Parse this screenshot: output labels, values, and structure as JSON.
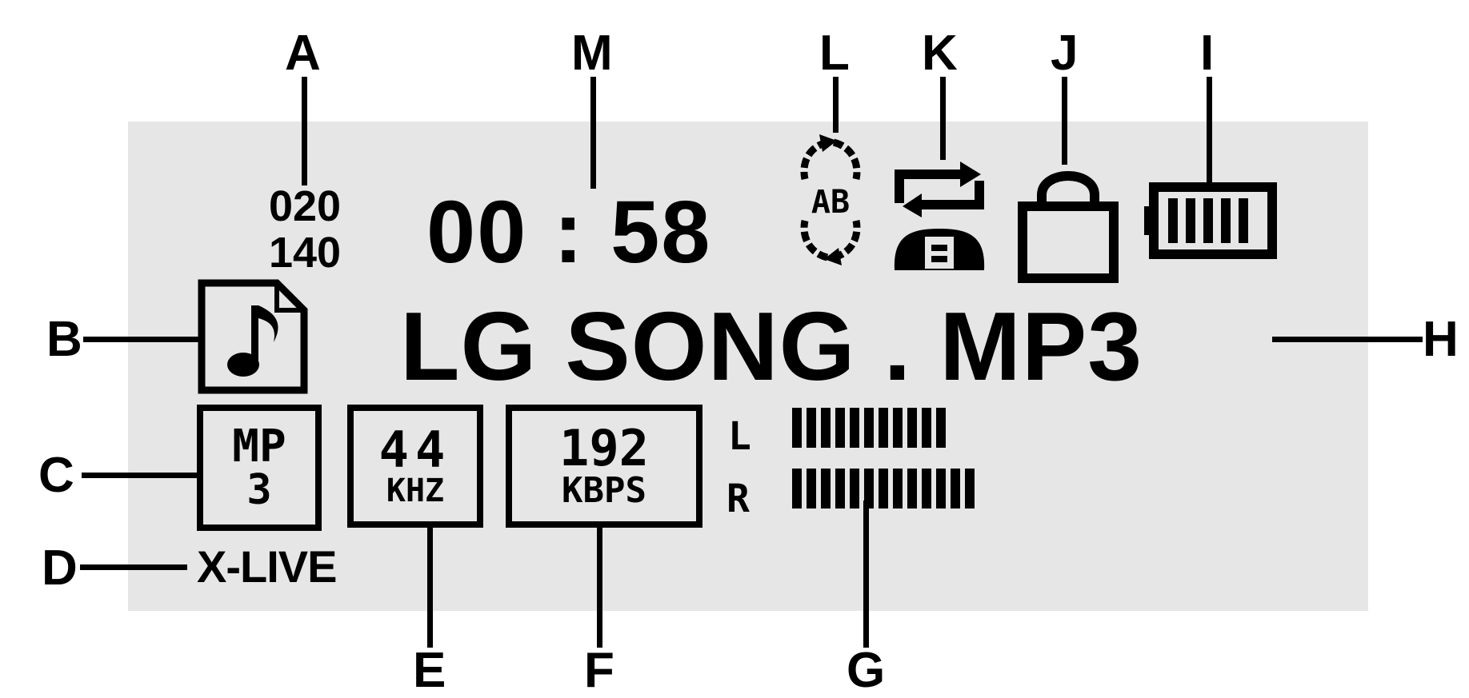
{
  "display": {
    "track_current": "020",
    "track_total": "140",
    "time": "00 : 58",
    "filename": "LG SONG . MP3",
    "format_top": "MP",
    "format_bottom": "3",
    "sample_rate_value": "44",
    "sample_rate_unit": "KHZ",
    "bitrate_value": "192",
    "bitrate_unit": "KBPS",
    "channel_left": "L",
    "channel_right": "R",
    "sound_effect": "X-LIVE",
    "ab_repeat": "AB",
    "level_left_bars": 11,
    "level_right_bars": 13,
    "battery_bars": 5
  },
  "callouts": {
    "a": "A",
    "b": "B",
    "c": "C",
    "d": "D",
    "e": "E",
    "f": "F",
    "g": "G",
    "h": "H",
    "i": "I",
    "j": "J",
    "k": "K",
    "l": "L",
    "m": "M"
  },
  "icons": {
    "file": "music-file-icon",
    "ab": "ab-repeat-icon",
    "repeat": "repeat-mode-icon",
    "lock": "lock-icon",
    "battery": "battery-icon"
  },
  "colors": {
    "panel": "#e6e6e6",
    "ink": "#000000"
  }
}
